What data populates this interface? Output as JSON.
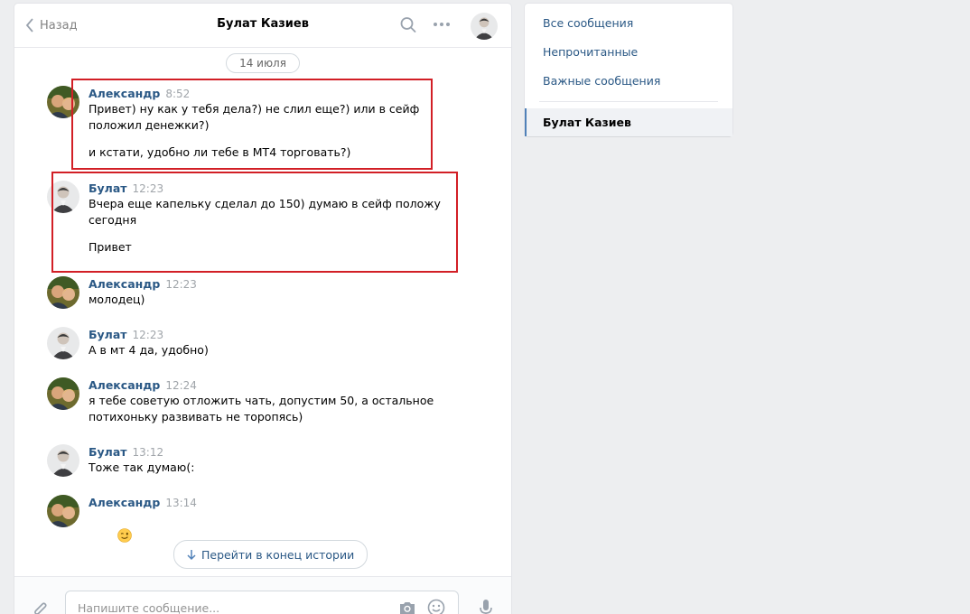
{
  "header": {
    "back_label": "Назад",
    "title": "Булат Казиев",
    "icons": [
      "search-icon",
      "more-icon"
    ]
  },
  "date_divider": "14 июля",
  "messages": [
    {
      "author": "Александр",
      "time": "8:52",
      "lines": [
        "Привет) ну как у тебя дела?) не слил еще?) или в сейф\nположил денежки?)",
        "и кстати, удобно ли тебе в МТ4 торговать?)"
      ]
    },
    {
      "author": "Булат",
      "time": "12:23",
      "lines": [
        "Вчера еще капельку сделал до 150) думаю в сейф положу\nсегодня",
        "Привет"
      ]
    },
    {
      "author": "Александр",
      "time": "12:23",
      "lines": [
        "молодец)"
      ]
    },
    {
      "author": "Булат",
      "time": "12:23",
      "lines": [
        "А в мт 4 да, удобно)"
      ]
    },
    {
      "author": "Александр",
      "time": "12:24",
      "lines": [
        "я тебе советую отложить чать, допустим 50, а остальное\nпотихоньку развивать не торопясь)"
      ]
    },
    {
      "author": "Булат",
      "time": "13:12",
      "lines": [
        "Тоже так думаю(:"
      ]
    },
    {
      "author": "Александр",
      "time": "13:14",
      "lines": [
        "wink-emoji"
      ]
    }
  ],
  "jump_button": "Перейти в конец истории",
  "composer": {
    "placeholder": "Напишите сообщение..."
  },
  "sidebar": {
    "items": [
      "Все сообщения",
      "Непрочитанные",
      "Важные сообщения"
    ],
    "active_conversation": "Булат Казиев"
  },
  "colors": {
    "link": "#2a5885",
    "accent": "#5181b8",
    "highlight": "#d21f26",
    "background": "#edeef0"
  }
}
